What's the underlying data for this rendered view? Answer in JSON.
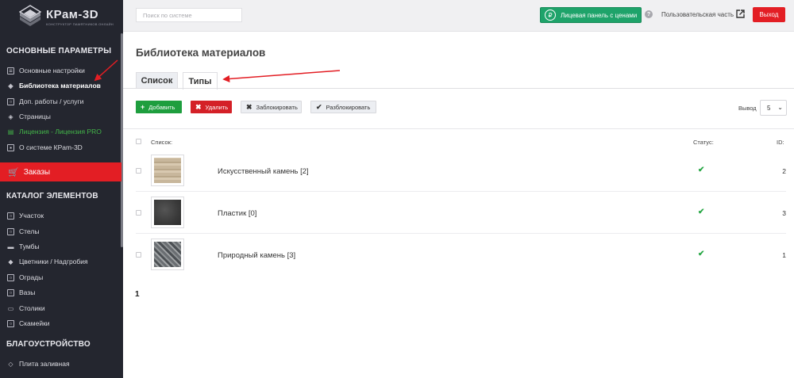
{
  "app": {
    "logo_title": "КРам-3D",
    "logo_subtitle": "КОНСТРУКТОР ПАМЯТНИКОВ ОНЛАЙН"
  },
  "sidebar": {
    "sections": [
      {
        "title": "ОСНОВНЫЕ ПАРАМЕТРЫ"
      },
      {
        "title": "КАТАЛОГ ЭЛЕМЕНТОВ"
      },
      {
        "title": "БЛАГОУСТРОЙСТВО"
      }
    ],
    "main_items": [
      {
        "label": "Основные настройки",
        "icon": "settings-icon"
      },
      {
        "label": "Библиотека материалов",
        "icon": "library-icon"
      },
      {
        "label": "Доп. работы / услуги",
        "icon": "services-icon"
      },
      {
        "label": "Страницы",
        "icon": "pages-icon"
      },
      {
        "label": "Лицензия - Лицензия PRO",
        "icon": "license-icon"
      },
      {
        "label": "О системе КРam-3D",
        "icon": "info-icon"
      }
    ],
    "orders_label": "Заказы",
    "catalog_items": [
      {
        "label": "Участок"
      },
      {
        "label": "Стелы"
      },
      {
        "label": "Тумбы"
      },
      {
        "label": "Цветники / Надгробия"
      },
      {
        "label": "Ограды"
      },
      {
        "label": "Вазы"
      },
      {
        "label": "Столики"
      },
      {
        "label": "Скамейки"
      }
    ],
    "improvement_items": [
      {
        "label": "Плита заливная"
      }
    ]
  },
  "topbar": {
    "search_placeholder": "Поиск по системе",
    "price_panel_label": "Лицевая панель с ценами",
    "user_part_label": "Пользовательская часть",
    "logout_label": "Выход"
  },
  "main": {
    "title": "Библиотека материалов",
    "tabs": [
      {
        "label": "Список"
      },
      {
        "label": "Типы"
      }
    ],
    "toolbar": {
      "add_label": "Добавить",
      "delete_label": "Удалить",
      "lock_label": "Заблокировать",
      "unlock_label": "Разблокировать",
      "show_label": "Вывод",
      "show_value": "5"
    },
    "table": {
      "headers": {
        "list": "Список:",
        "status": "Статус:",
        "id": "ID:"
      },
      "rows": [
        {
          "name": "Искусственный камень [2]",
          "status": "✔",
          "id": "2"
        },
        {
          "name": "Пластик [0]",
          "status": "✔",
          "id": "3"
        },
        {
          "name": "Природный камень [3]",
          "status": "✔",
          "id": "1"
        }
      ]
    },
    "pagination": {
      "current": "1"
    }
  },
  "colors": {
    "sidebar_bg": "#24262f",
    "accent_red": "#e31e24",
    "accent_green": "#1ea36a",
    "license_green": "#43b649"
  }
}
